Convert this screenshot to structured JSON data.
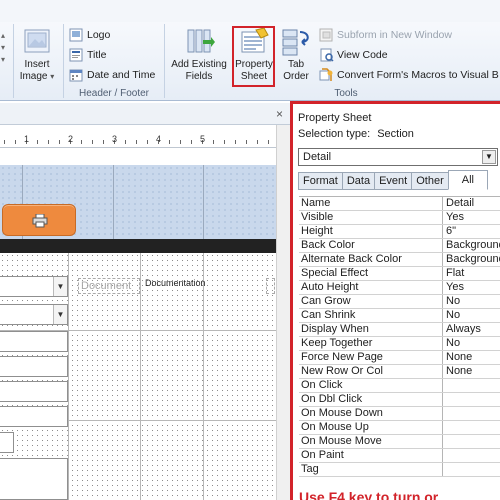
{
  "ribbon": {
    "insert_image": {
      "label_line1": "Insert",
      "label_line2": "Image",
      "arrow": "▾"
    },
    "header_footer": {
      "logo": "Logo",
      "title": "Title",
      "date_time": "Date and Time",
      "group_label": "Header / Footer"
    },
    "add_existing_fields": {
      "line1": "Add Existing",
      "line2": "Fields"
    },
    "property_sheet": {
      "line1": "Property",
      "line2": "Sheet"
    },
    "tab_order": {
      "line1": "Tab",
      "line2": "Order"
    },
    "tools": {
      "subform_new_window": "Subform in New Window",
      "view_code": "View Code",
      "convert_macros": "Convert Form's Macros to Visual B",
      "group_label": "Tools"
    }
  },
  "design": {
    "close_glyph": "×",
    "ruler_numbers": [
      "1",
      "2",
      "3",
      "4",
      "5"
    ],
    "label_document": "Document",
    "label_documentation": "Documentation"
  },
  "property_sheet": {
    "title": "Property Sheet",
    "selection_type_label": "Selection type:",
    "selection_type_value": "Section",
    "selected_object": "Detail",
    "tabs": [
      "Format",
      "Data",
      "Event",
      "Other",
      "All"
    ],
    "active_tab": "All",
    "properties": [
      {
        "name": "Name",
        "value": "Detail"
      },
      {
        "name": "Visible",
        "value": "Yes"
      },
      {
        "name": "Height",
        "value": "6\""
      },
      {
        "name": "Back Color",
        "value": "Background"
      },
      {
        "name": "Alternate Back Color",
        "value": "Background"
      },
      {
        "name": "Special Effect",
        "value": "Flat"
      },
      {
        "name": "Auto Height",
        "value": "Yes"
      },
      {
        "name": "Can Grow",
        "value": "No"
      },
      {
        "name": "Can Shrink",
        "value": "No"
      },
      {
        "name": "Display When",
        "value": "Always"
      },
      {
        "name": "Keep Together",
        "value": "No"
      },
      {
        "name": "Force New Page",
        "value": "None"
      },
      {
        "name": "New Row Or Col",
        "value": "None"
      },
      {
        "name": "On Click",
        "value": ""
      },
      {
        "name": "On Dbl Click",
        "value": ""
      },
      {
        "name": "On Mouse Down",
        "value": ""
      },
      {
        "name": "On Mouse Up",
        "value": ""
      },
      {
        "name": "On Mouse Move",
        "value": ""
      },
      {
        "name": "On Paint",
        "value": ""
      },
      {
        "name": "Tag",
        "value": ""
      }
    ],
    "annotation": "Use F4 key to turn or"
  },
  "colors": {
    "highlight_red": "#d2232a",
    "section_blue": "#c9d8ec",
    "button_orange": "#ee8a3e"
  }
}
